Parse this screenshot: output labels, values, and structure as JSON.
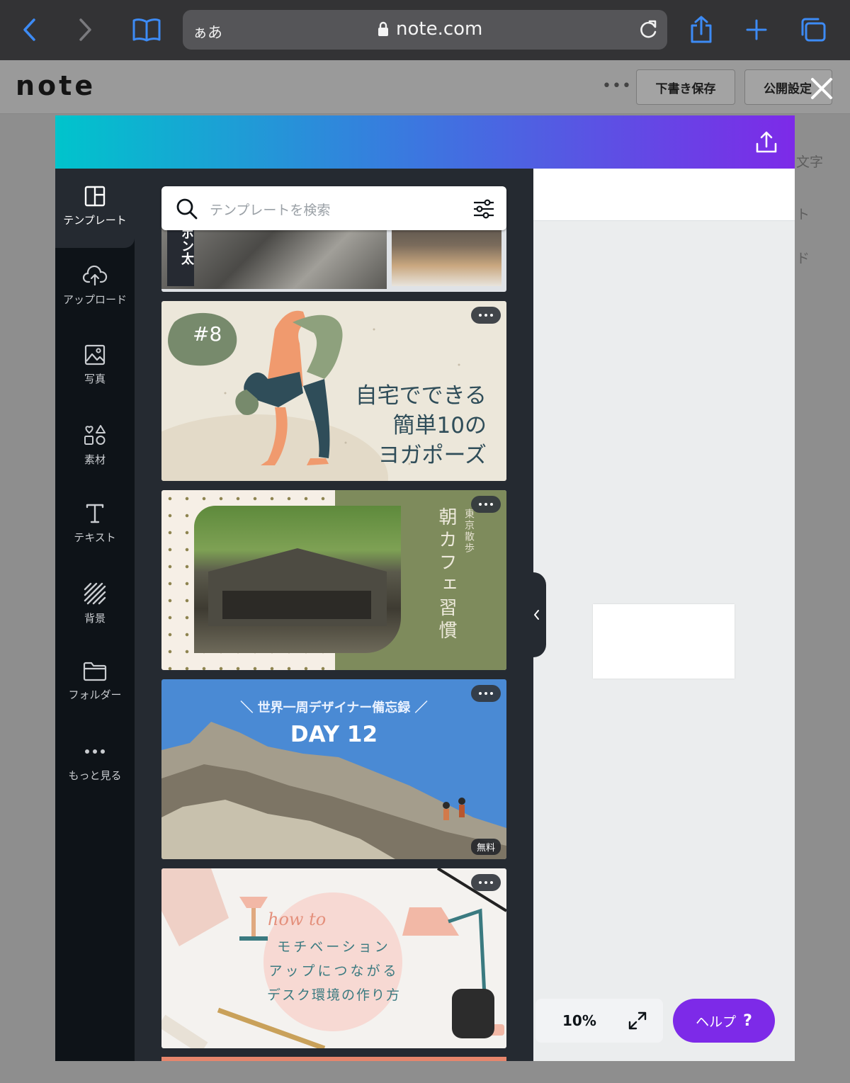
{
  "browser": {
    "text_size_label": "ぁあ",
    "host": "note.com"
  },
  "note_header": {
    "logo": "note",
    "save_draft_label": "下書き保存",
    "publish_settings_label": "公開設定"
  },
  "background_side_texts": [
    "文字",
    "ト",
    "ド"
  ],
  "canva": {
    "nav": [
      {
        "label": "テンプレート",
        "icon": "template-icon"
      },
      {
        "label": "アップロード",
        "icon": "cloud-upload-icon"
      },
      {
        "label": "写真",
        "icon": "photo-icon"
      },
      {
        "label": "素材",
        "icon": "elements-icon"
      },
      {
        "label": "テキスト",
        "icon": "text-icon"
      },
      {
        "label": "背景",
        "icon": "background-pattern-icon"
      },
      {
        "label": "フォルダー",
        "icon": "folder-icon"
      },
      {
        "label": "もっと見る",
        "icon": "more-icon"
      }
    ],
    "search": {
      "placeholder": "テンプレートを検索"
    },
    "templates": {
      "yoga": {
        "badge": "#8",
        "lines": [
          "自宅でできる",
          "簡単10の",
          "ヨガポーズ"
        ]
      },
      "cafe": {
        "title": "朝カフェ習慣",
        "subtitle": "東京散歩"
      },
      "climb": {
        "header": "＼ 世界一周デザイナー備忘録 ／",
        "day": "DAY 12",
        "free_badge": "無料"
      },
      "desk": {
        "script": "how to",
        "lines": [
          "モチベーション",
          "アップにつながる",
          "デスク環境の作り方"
        ]
      },
      "partial_top_text": "ポン太"
    },
    "zoom_level": "10%",
    "help_label": "ヘルプ",
    "help_mark": "?"
  },
  "colors": {
    "canva_gradient_start": "#00c4cc",
    "canva_gradient_end": "#7d2ae8",
    "help_button": "#7d2ae8",
    "sidebar": "#0e1318",
    "panel": "#252a31"
  }
}
